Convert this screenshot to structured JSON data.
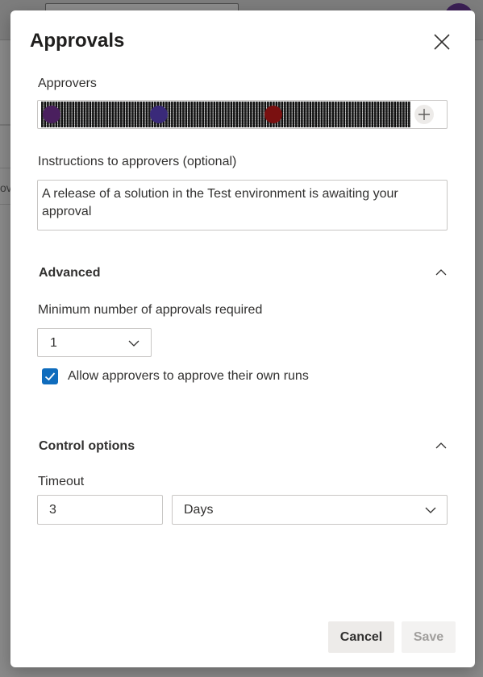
{
  "dialog": {
    "title": "Approvals"
  },
  "approvers": {
    "label": "Approvers",
    "add_icon": "plus-icon"
  },
  "instructions": {
    "label": "Instructions to approvers (optional)",
    "value": "A release of a solution in the Test environment is awaiting your approval"
  },
  "advanced": {
    "title": "Advanced",
    "min_approvals_label": "Minimum number of approvals required",
    "min_approvals_value": "1",
    "allow_self_approve_label": "Allow approvers to approve their own runs",
    "allow_self_approve_checked": true
  },
  "control_options": {
    "title": "Control options",
    "timeout_label": "Timeout",
    "timeout_value": "3",
    "timeout_unit": "Days"
  },
  "footer": {
    "cancel_label": "Cancel",
    "save_label": "Save"
  },
  "background": {
    "partial_text": "ov"
  },
  "colors": {
    "accent": "#0f6cbd",
    "avatar_purple": "#3b1f55"
  }
}
